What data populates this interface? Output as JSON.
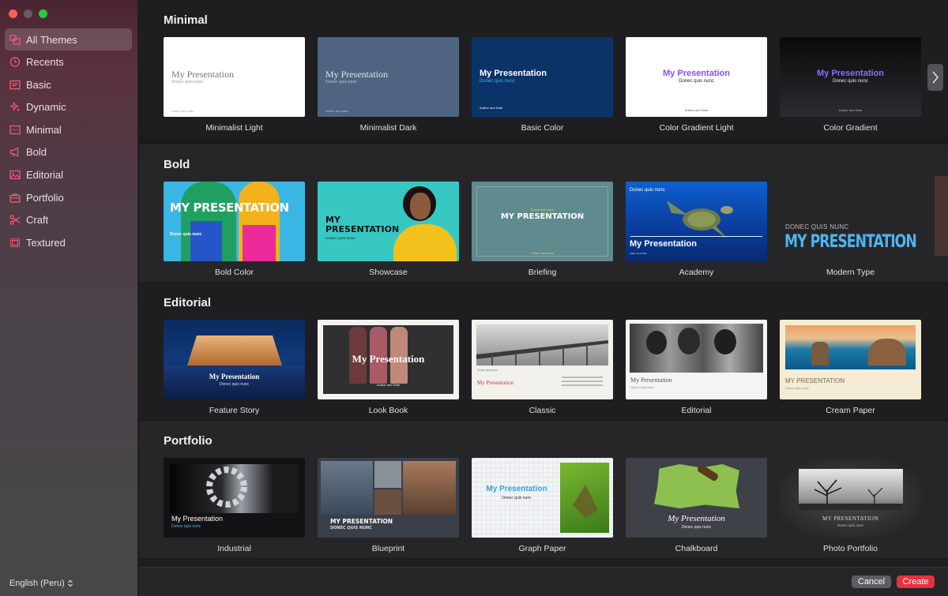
{
  "sidebar": {
    "items": [
      {
        "label": "All Themes",
        "icon": "all-themes-icon"
      },
      {
        "label": "Recents",
        "icon": "clock-icon"
      },
      {
        "label": "Basic",
        "icon": "basic-icon"
      },
      {
        "label": "Dynamic",
        "icon": "sparkle-icon"
      },
      {
        "label": "Minimal",
        "icon": "minimal-icon"
      },
      {
        "label": "Bold",
        "icon": "megaphone-icon"
      },
      {
        "label": "Editorial",
        "icon": "photo-icon"
      },
      {
        "label": "Portfolio",
        "icon": "briefcase-icon"
      },
      {
        "label": "Craft",
        "icon": "scissors-icon"
      },
      {
        "label": "Textured",
        "icon": "textured-icon"
      }
    ],
    "language": "English (Peru)"
  },
  "sections": [
    {
      "title": "Minimal",
      "themes": [
        "Minimalist Light",
        "Minimalist Dark",
        "Basic Color",
        "Color Gradient Light",
        "Color Gradient"
      ]
    },
    {
      "title": "Bold",
      "themes": [
        "Bold Color",
        "Showcase",
        "Briefing",
        "Academy",
        "Modern Type"
      ]
    },
    {
      "title": "Editorial",
      "themes": [
        "Feature Story",
        "Look Book",
        "Classic",
        "Editorial",
        "Cream Paper"
      ]
    },
    {
      "title": "Portfolio",
      "themes": [
        "Industrial",
        "Blueprint",
        "Graph Paper",
        "Chalkboard",
        "Photo Portfolio"
      ]
    }
  ],
  "thumb_text": {
    "my_presentation": "My Presentation",
    "my_presentation_caps": "MY PRESENTATION",
    "subtitle": "Donec quis nunc",
    "subtitle_caps": "DONEC QUIS NUNC",
    "author": "Author and Date",
    "author_lc": "Author and date",
    "my": "MY",
    "presentation": "PRESENTATION"
  },
  "footer": {
    "cancel": "Cancel",
    "create": "Create"
  },
  "colors": {
    "accent": "#e4323f",
    "sidebar_icon": "#ff5a7a"
  }
}
